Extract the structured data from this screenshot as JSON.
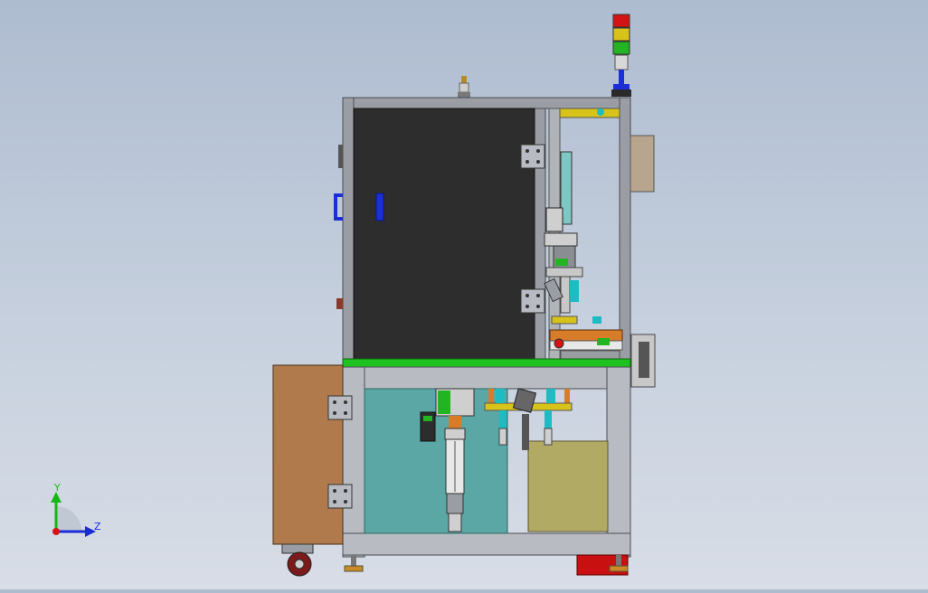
{
  "viewport": {
    "background_top": "#aebcd0",
    "background_bottom": "#d8dde6"
  },
  "colors": {
    "frame": "#9a9ea4",
    "frame_dark": "#4a4e54",
    "door": "#2d2d2d",
    "base_plate": "#1fc21f",
    "cabinet_box": "#b07a4c",
    "teal_panel": "#5aa7a5",
    "olive_box": "#b1aa64",
    "accent_blue": "#1b2fd6",
    "signal_red": "#d41414",
    "signal_yellow": "#d8c31a",
    "signal_green": "#22b422",
    "copper": "#d77d2a",
    "cyan_part": "#1ebcc2"
  },
  "triad": {
    "y_label": "Y",
    "z_label": "Z",
    "y_color": "#16b816",
    "z_color": "#1a2bd8",
    "x_color": "#d41414"
  }
}
